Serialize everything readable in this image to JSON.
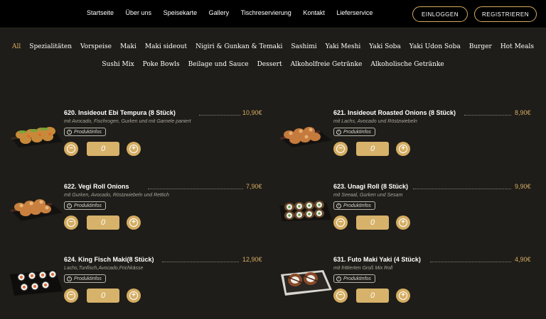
{
  "nav": {
    "links": [
      "Startseite",
      "Über uns",
      "Speisekarte",
      "Gallery",
      "Tischreservierung",
      "Kontakt",
      "Lieferservice"
    ],
    "login": "EINLOGGEN",
    "register": "REGISTRIEREN"
  },
  "categories": {
    "row1": [
      "All",
      "Spezialitäten",
      "Vorspeise",
      "Maki",
      "Maki sideout",
      "Nigiri & Gunkan & Temaki",
      "Sashimi",
      "Yaki Meshi",
      "Yaki Soba",
      "Yaki Udon Soba",
      "Burger",
      "Hot Meals"
    ],
    "row2": [
      "Sushi Mix",
      "Poke Bowls",
      "Beilage und Sauce",
      "Dessert",
      "Alkoholfreie Getränke",
      "Alkoholische Getränke"
    ],
    "active": "All"
  },
  "products": [
    {
      "title": "620. Insideout Ebi Tempura (8 Stück)",
      "desc": "mit Avocado, Fischrogen, Gurken und mit Garnele paniert",
      "price": "10,90€",
      "info": "Produktinfos",
      "qty": "0"
    },
    {
      "title": "621. Insideout Roasted Onions (8 Stück)",
      "desc": "mit Lachs, Avocado und Röstzwiebeln",
      "price": "8,90€",
      "info": "Produktinfos",
      "qty": "0"
    },
    {
      "title": "622. Vegi Roll Onions",
      "desc": "mit Gurken, Avocado, Röstzwiebeln und Rettich",
      "price": "7,90€",
      "info": "Produktinfos",
      "qty": "0"
    },
    {
      "title": "623. Unagi Roll (8 Stück)",
      "desc": "mit Seeaal, Gurken und Sesam",
      "price": "9,90€",
      "info": "Produktinfos",
      "qty": "0"
    },
    {
      "title": "624. King Fisch Maki(8 Stück)",
      "desc": "Lachs,Tunfisch,Avocado,Frichkässe",
      "price": "12,90€",
      "info": "Produktinfos",
      "qty": "0"
    },
    {
      "title": "631. Futo Maki Yaki (4 Stück)",
      "desc": "mit frittierten Groß Mix Roll",
      "price": "4,90€",
      "info": "Produktinfos",
      "qty": "0"
    }
  ],
  "icons": {
    "minus": "minus-circle-icon",
    "plus": "plus-circle-icon",
    "info": "info-icon"
  },
  "colors": {
    "accent": "#d4ad62",
    "background": "#1f1d19",
    "topbar": "#000000"
  }
}
